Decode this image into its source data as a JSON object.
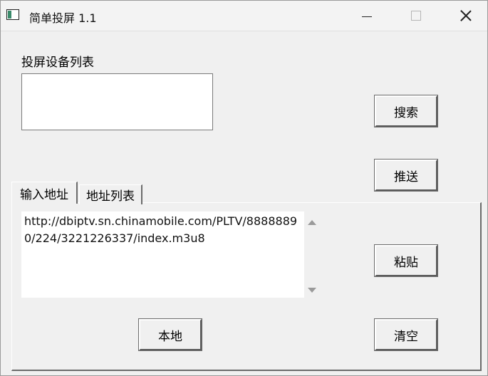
{
  "window": {
    "title": "简单投屏 1.1"
  },
  "devices": {
    "label": "投屏设备列表",
    "items": []
  },
  "buttons": {
    "search": "搜索",
    "push": "推送",
    "paste": "粘贴",
    "local": "本地",
    "clear": "清空"
  },
  "tabs": [
    {
      "label": "输入地址",
      "active": true
    },
    {
      "label": "地址列表",
      "active": false
    }
  ],
  "url_input": {
    "value": "http://dbiptv.sn.chinamobile.com/PLTV/88888890/224/3221226337/index.m3u8"
  },
  "icons": {
    "app": "app-window-icon",
    "minimize": "minimize-icon",
    "maximize": "maximize-icon",
    "close": "close-icon",
    "scroll_up": "scroll-up-arrow-icon",
    "scroll_down": "scroll-down-arrow-icon"
  }
}
